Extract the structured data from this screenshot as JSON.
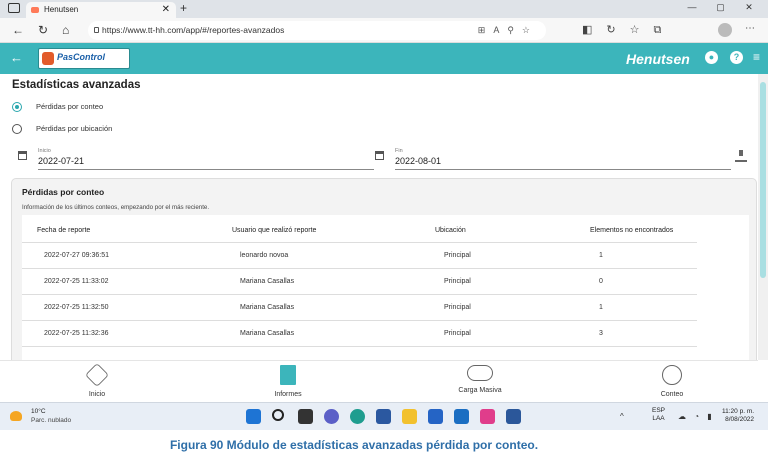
{
  "browser": {
    "tab_title": "Henutsen",
    "tab_close": "✕",
    "new_tab": "+",
    "url": "https://www.tt-hh.com/app/#/reportes-avanzados",
    "win_min": "—",
    "win_max": "▢",
    "win_close": "✕"
  },
  "app": {
    "logo_text": "PasControl",
    "brand": "Henutsen",
    "user_icon": "person-icon",
    "help_icon": "?"
  },
  "page": {
    "title": "Estadísticas avanzadas",
    "radio_conteo": "Pérdidas por conteo",
    "radio_ubicacion": "Pérdidas por ubicación",
    "inicio_label": "Inicio",
    "inicio_value": "2022-07-21",
    "fin_label": "Fin",
    "fin_value": "2022-08-01"
  },
  "card": {
    "title": "Pérdidas por conteo",
    "subtitle": "Información de los últimos conteos, empezando por el más reciente.",
    "columns": [
      "Fecha de reporte",
      "Usuario que realizó reporte",
      "Ubicación",
      "Elementos no encontrados"
    ],
    "rows": [
      [
        "2022-07-27 09:36:51",
        "leonardo novoa",
        "Principal",
        "1"
      ],
      [
        "2022-07-25 11:33:02",
        "Mariana Casallas",
        "Principal",
        "0"
      ],
      [
        "2022-07-25 11:32:50",
        "Mariana Casallas",
        "Principal",
        "1"
      ],
      [
        "2022-07-25 11:32:36",
        "Mariana Casallas",
        "Principal",
        "3"
      ]
    ]
  },
  "bottom_nav": {
    "inicio": "Inicio",
    "informes": "Informes",
    "carga": "Carga Masiva",
    "conteo": "Conteo"
  },
  "taskbar": {
    "temp": "10°C",
    "weather": "Parc. nublado",
    "lang_1": "ESP",
    "lang_2": "LAA",
    "time": "11:20 p. m.",
    "date": "8/08/2022",
    "tray_chevron": "^"
  },
  "caption": "Figura 90 Módulo de estadísticas avanzadas pérdida por conteo.",
  "colors": {
    "accent": "#3cb5bb",
    "caption": "#2f6fa8"
  }
}
